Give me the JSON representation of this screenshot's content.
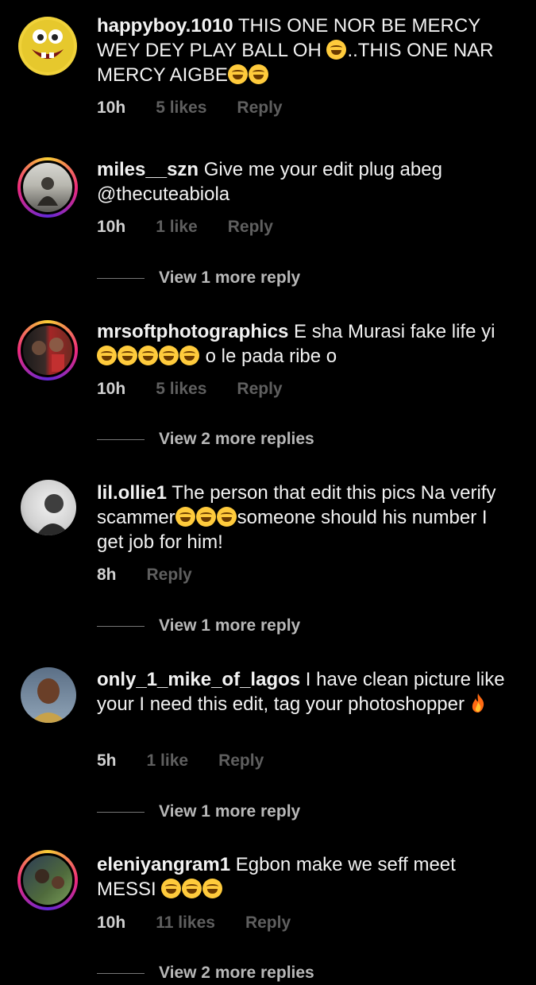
{
  "comments": [
    {
      "username": "happyboy.1010",
      "text_parts": [
        "THIS ONE NOR BE MERCY WEY DEY PLAY BALL OH ",
        "..THIS ONE NAR MERCY AIGBE"
      ],
      "time": "10h",
      "likes": "5 likes",
      "reply": "Reply",
      "view_more": ""
    },
    {
      "username": "miles__szn",
      "text": "Give me your edit plug abeg @thecuteabiola",
      "time": "10h",
      "likes": "1 like",
      "reply": "Reply",
      "view_more": "View 1 more reply"
    },
    {
      "username": "mrsoftphotographics",
      "text_parts": [
        "E sha Murasi fake life yi ",
        " o le pada ribe o"
      ],
      "time": "10h",
      "likes": "5 likes",
      "reply": "Reply",
      "view_more": "View 2 more replies"
    },
    {
      "username": "lil.ollie1",
      "text_parts": [
        "The person that edit this pics Na verify scammer",
        "someone should his number I get job for him!"
      ],
      "time": "8h",
      "likes": "",
      "reply": "Reply",
      "view_more": "View 1 more reply"
    },
    {
      "username": "only_1_mike_of_lagos",
      "text": "I have clean picture like your I need this edit, tag your photoshopper ",
      "time": "5h",
      "likes": "1 like",
      "reply": "Reply",
      "view_more": "View 1 more reply"
    },
    {
      "username": "eleniyangram1",
      "text": "Egbon make we seff meet MESSI ",
      "time": "10h",
      "likes": "11 likes",
      "reply": "Reply",
      "view_more": "View 2 more replies"
    }
  ],
  "icons": {
    "laughing": "face-with-tears-of-joy-icon",
    "fire": "fire-icon"
  }
}
